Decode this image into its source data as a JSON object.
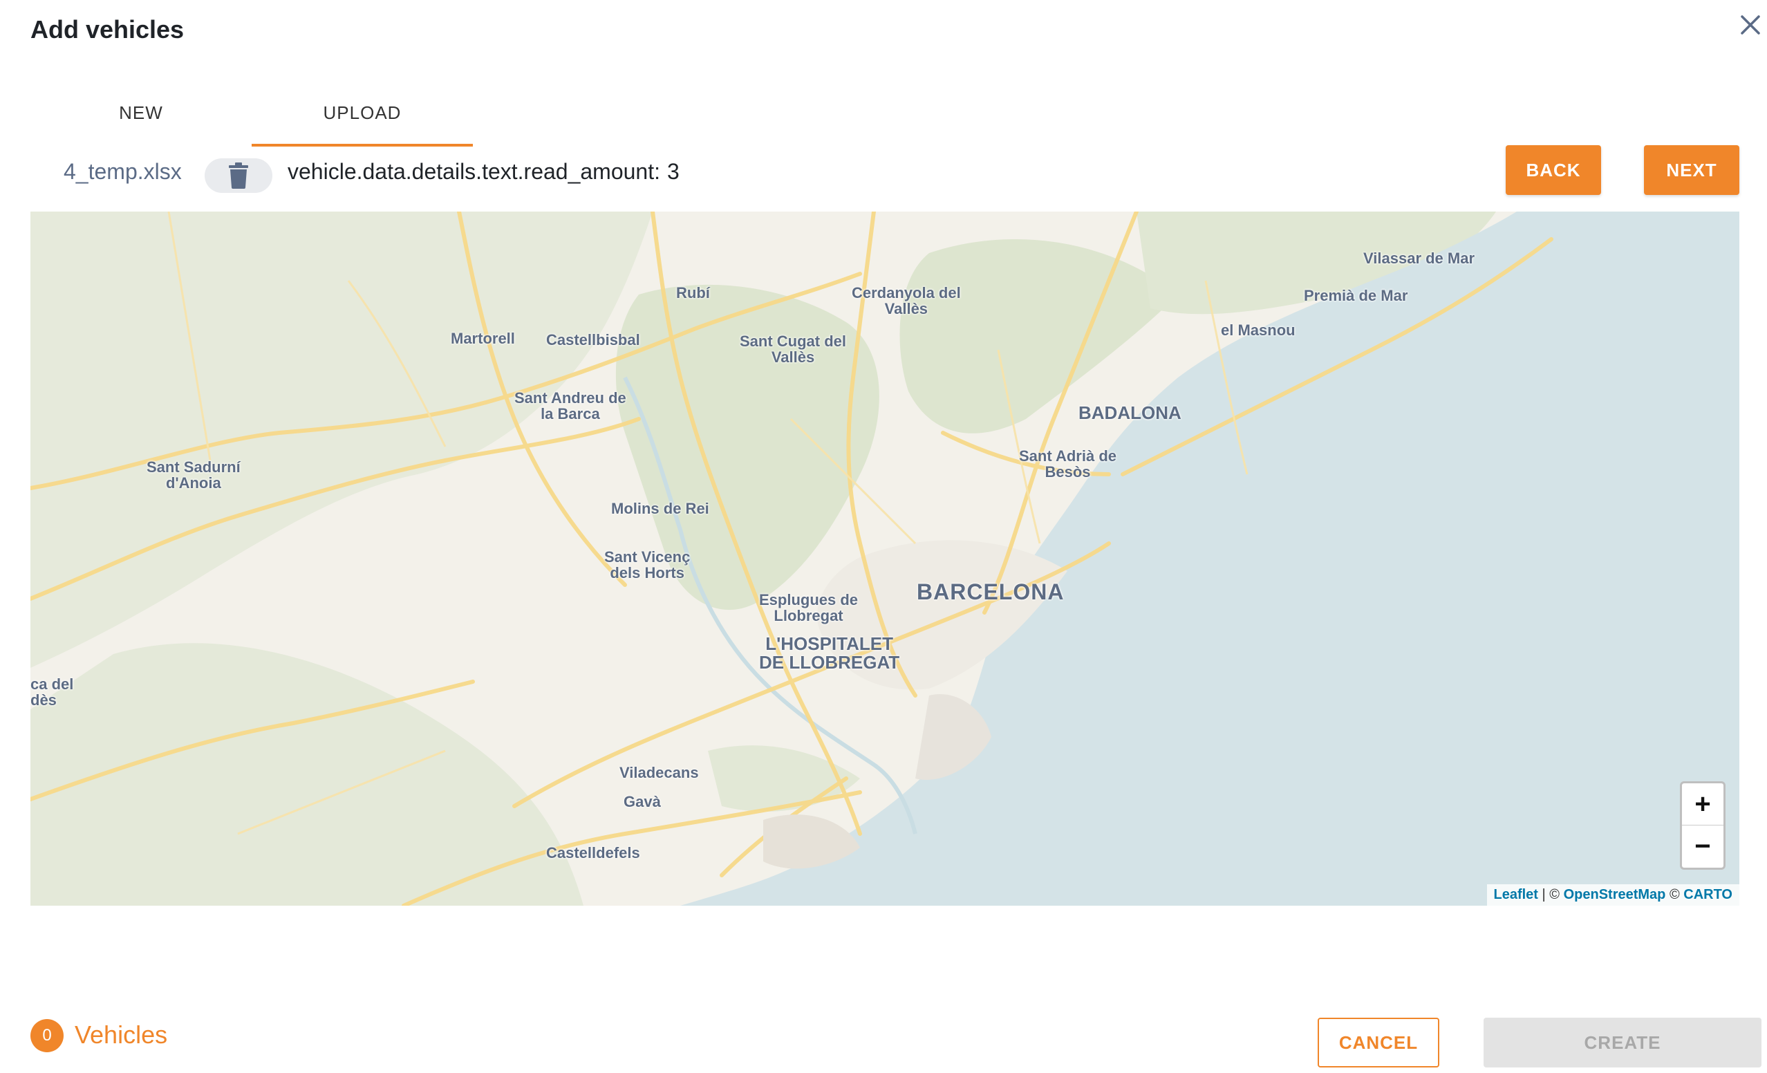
{
  "dialog": {
    "title": "Add vehicles"
  },
  "tabs": [
    {
      "label": "NEW",
      "active": false
    },
    {
      "label": "UPLOAD",
      "active": true
    }
  ],
  "upload": {
    "file_name": "4_temp.xlsx",
    "read_amount_label": "vehicle.data.details.text.read_amount:",
    "read_amount_value": "3",
    "back_label": "BACK",
    "next_label": "NEXT"
  },
  "map": {
    "labels": {
      "rubi": "Rubí",
      "cerdanyola": "Cerdanyola del\nVallès",
      "vilassar": "Vilassar de Mar",
      "premia": "Premià de Mar",
      "masnou": "el Masnou",
      "martorell": "Martorell",
      "castellbisbal": "Castellbisbal",
      "sant_cugat": "Sant Cugat del\nVallès",
      "sant_andreu": "Sant Andreu de\nla Barca",
      "badalona": "BADALONA",
      "sant_adria": "Sant Adrià de\nBesòs",
      "sant_sadurni": "Sant Sadurní\nd'Anoia",
      "molins": "Molins de Rei",
      "sant_vicenc": "Sant Vicenç\ndels Horts",
      "esplugues": "Esplugues de\nLlobregat",
      "barcelona": "BARCELONA",
      "hospitalet": "L'HOSPITALET\nDE LLOBREGAT",
      "partial_left": "ca del\ndès",
      "viladecans": "Viladecans",
      "gava": "Gavà",
      "castelldefels": "Castelldefels"
    },
    "zoom_in": "+",
    "zoom_out": "−",
    "attribution": {
      "leaflet": "Leaflet",
      "sep1": " | © ",
      "osm": "OpenStreetMap",
      "sep2": " © ",
      "carto": "CARTO"
    },
    "colors": {
      "land": "#f3f1ea",
      "green": "#dfe6d2",
      "water": "#d4e3e7",
      "road": "#f7d98a"
    }
  },
  "footer": {
    "vehicle_count": "0",
    "vehicles_label": "Vehicles",
    "cancel_label": "CANCEL",
    "create_label": "CREATE"
  },
  "colors": {
    "accent": "#f0862a",
    "disabled_bg": "#e3e3e3",
    "disabled_text": "#a8a8a8"
  }
}
